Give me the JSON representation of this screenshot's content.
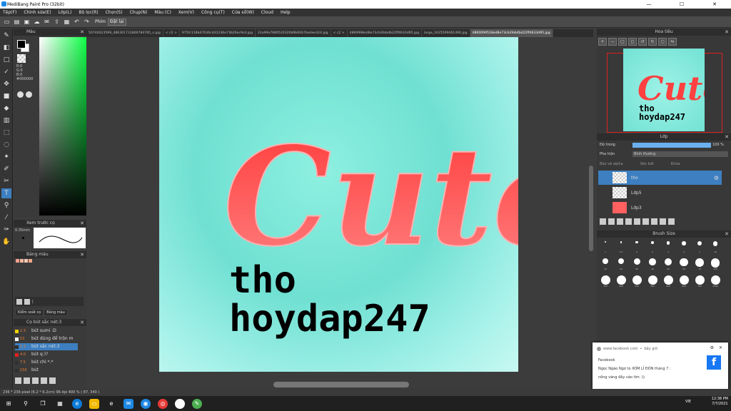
{
  "window": {
    "title": "MediBang Paint Pro (32bit)",
    "minimize": "—",
    "maximize": "☐",
    "close": "✕"
  },
  "menu": [
    "Tệp(F)",
    "Chỉnh sửa(E)",
    "Lớp(L)",
    "Bộ lọc(R)",
    "Chọn(S)",
    "Chụp(N)",
    "Màu (C)",
    "Xem(V)",
    "Công cụ(T)",
    "Cửa sổ(W)",
    "Cloud",
    "Help"
  ],
  "toolbar": {
    "pen_label": "Phím",
    "erase_label": "Đặt lại"
  },
  "color_panel": {
    "title": "Màu",
    "r": "R:0",
    "g": "G:0",
    "b": "B:0",
    "hex": "#000000"
  },
  "brush_preview": {
    "title": "Xem trước cọ",
    "size": "0.35mm"
  },
  "palette": {
    "title": "Bảng màu",
    "swatches": [
      "#f4a090",
      "#f8b8a0",
      "#fcc8b4",
      "#f0a888"
    ],
    "tabs": [
      "Kiểm soát cọ",
      "Bảng màu"
    ]
  },
  "brush_list": {
    "title": "Cọ bút sắc nét:3",
    "items": [
      {
        "size": "2.3",
        "name": "bút sumi :D",
        "color": "#f0d000"
      },
      {
        "size": "53",
        "name": "bút dùng để trộn m",
        "color": "#ffffff"
      },
      {
        "size": "1.3",
        "name": "bút sắc nét:3",
        "color": "#303030"
      },
      {
        "size": "4.0",
        "name": "bút q:)?",
        "color": "#e02020"
      },
      {
        "size": "7.5",
        "name": "bút chì *.*",
        "color": "#303030"
      },
      {
        "size": "150",
        "name": "bút",
        "color": "#303030"
      }
    ]
  },
  "file_tabs": [
    "50746023599_486301731866784785_n.jpg",
    "< c2 >",
    "975fc118b47036c441236e73b26ec9cd.jpg",
    "31a99a7880520320b9b92b7bedee324.jpg",
    "< c2 >",
    "4869998ed8e73cb3febdb22ff4633d95.jpg",
    "large_1625569461490.jpg",
    "4860099518ed8e73cb3feb4bd22ff4633d95.jpg"
  ],
  "artwork": {
    "title": "Cute",
    "line1": "tho",
    "line2": "hoydap247"
  },
  "navigator": {
    "title": "Hoa tiêu"
  },
  "layers": {
    "title": "Lớp",
    "opacity_label": "Độ trong",
    "opacity_value": "100 %",
    "blend_label": "Pha trộn",
    "blend_value": "Bình thường",
    "alpha_label": "Bảo vệ alpha",
    "clip_label": "Xén bớt",
    "lock_label": "Khóa",
    "items": [
      {
        "name": "tho",
        "selected": true
      },
      {
        "name": "Lớp5",
        "selected": false
      },
      {
        "name": "Lớp3",
        "selected": false
      }
    ]
  },
  "brush_size": {
    "title": "Brush Size",
    "labels": [
      "1",
      "1.5",
      "2",
      "3",
      "4",
      "5",
      "7",
      "10",
      "15",
      "20",
      "25",
      "30",
      "40",
      "50",
      "70",
      "100",
      "150",
      "200",
      "250",
      "300",
      "400",
      "500",
      "700",
      "1000"
    ]
  },
  "status": "236 * 236 pixel  (6.2 * 6.2cm)  96 dpi  400 %  ( 87, 340 )",
  "notification": {
    "source": "www.facebook.com",
    "time": "bây giờ",
    "app": "Facebook",
    "title": "Ngọc Ngáo Ngơ to XÓM LỈ ĐÒN tháng 7 :",
    "body": "nồng vàng đây vào tim :))"
  },
  "clock": {
    "time": "12:38 PM",
    "date": "7/7/2021",
    "lang": "VIE"
  }
}
